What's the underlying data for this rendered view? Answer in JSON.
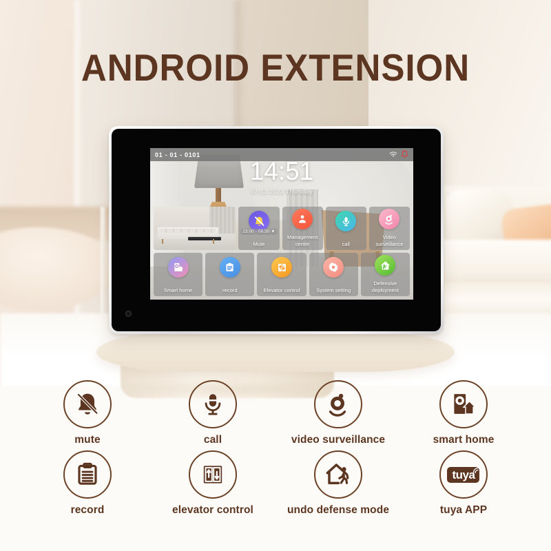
{
  "page": {
    "title": "ANDROID EXTENSION",
    "title_color": "#5c3620",
    "accent_color": "#6b4226"
  },
  "device": {
    "statusbar": {
      "device_id": "01 - 01 - 0101",
      "wifi_icon": "wifi-icon",
      "alarm_icon": "alarm-icon",
      "alarm_color": "#e03a3a"
    },
    "clock": {
      "time": "14:51",
      "date": "07-13 2023 Thursday"
    },
    "tiles": {
      "row1": [
        {
          "name": "photo",
          "label": "",
          "icon": "",
          "type": "photo"
        },
        {
          "name": "mute",
          "label": "Mute",
          "icon": "bell-mute-icon",
          "badge": "23:00 - 06:30 ▼",
          "color1": "#6a5ae0",
          "color2": "#7b6bf0"
        },
        {
          "name": "management-center",
          "label": "Management\ncenter",
          "icon": "person-icon",
          "color1": "#fc6a4a",
          "color2": "#f6583d"
        },
        {
          "name": "call",
          "label": "call",
          "icon": "microphone-icon",
          "color1": "#3fd6b0",
          "color2": "#46b9e8"
        },
        {
          "name": "video-surveillance",
          "label": "Video\nsurveillance",
          "icon": "camera-icon",
          "color1": "#f7a8c0",
          "color2": "#f48fb0"
        }
      ],
      "row2": [
        {
          "name": "smart-home",
          "label": "Smart home",
          "icon": "smart-home-icon",
          "color1": "#7e8ff3",
          "color2": "#f48fb0"
        },
        {
          "name": "record",
          "label": "record",
          "icon": "clipboard-icon",
          "color1": "#5aa9f0",
          "color2": "#4e92e6"
        },
        {
          "name": "elevator-control",
          "label": "Elevator control",
          "icon": "elevator-icon",
          "color1": "#ffc04a",
          "color2": "#f59e28"
        },
        {
          "name": "system-setting",
          "label": "System setting",
          "icon": "gear-icon",
          "color1": "#f8a99b",
          "color2": "#f59186"
        },
        {
          "name": "defensive-deployment",
          "label": "Defensive\ndeployment",
          "icon": "shield-home-icon",
          "color1": "#8ed94f",
          "color2": "#5fc03a"
        }
      ]
    }
  },
  "features": {
    "row1": [
      {
        "name": "mute",
        "label": "mute",
        "icon": "bell-mute-icon"
      },
      {
        "name": "call",
        "label": "call",
        "icon": "microphone-icon"
      },
      {
        "name": "video-surveillance",
        "label": "video surveillance",
        "icon": "camera-icon"
      },
      {
        "name": "smart-home",
        "label": "smart home",
        "icon": "smart-home-icon"
      }
    ],
    "row2": [
      {
        "name": "record",
        "label": "record",
        "icon": "clipboard-icon"
      },
      {
        "name": "elevator-control",
        "label": "elevator control",
        "icon": "elevator-icon"
      },
      {
        "name": "undo-defense-mode",
        "label": "undo defense mode",
        "icon": "house-walking-person-icon"
      },
      {
        "name": "tuya-app",
        "label": "tuya APP",
        "icon": "tuya-logo-icon",
        "logo_text": "tuya"
      }
    ]
  }
}
